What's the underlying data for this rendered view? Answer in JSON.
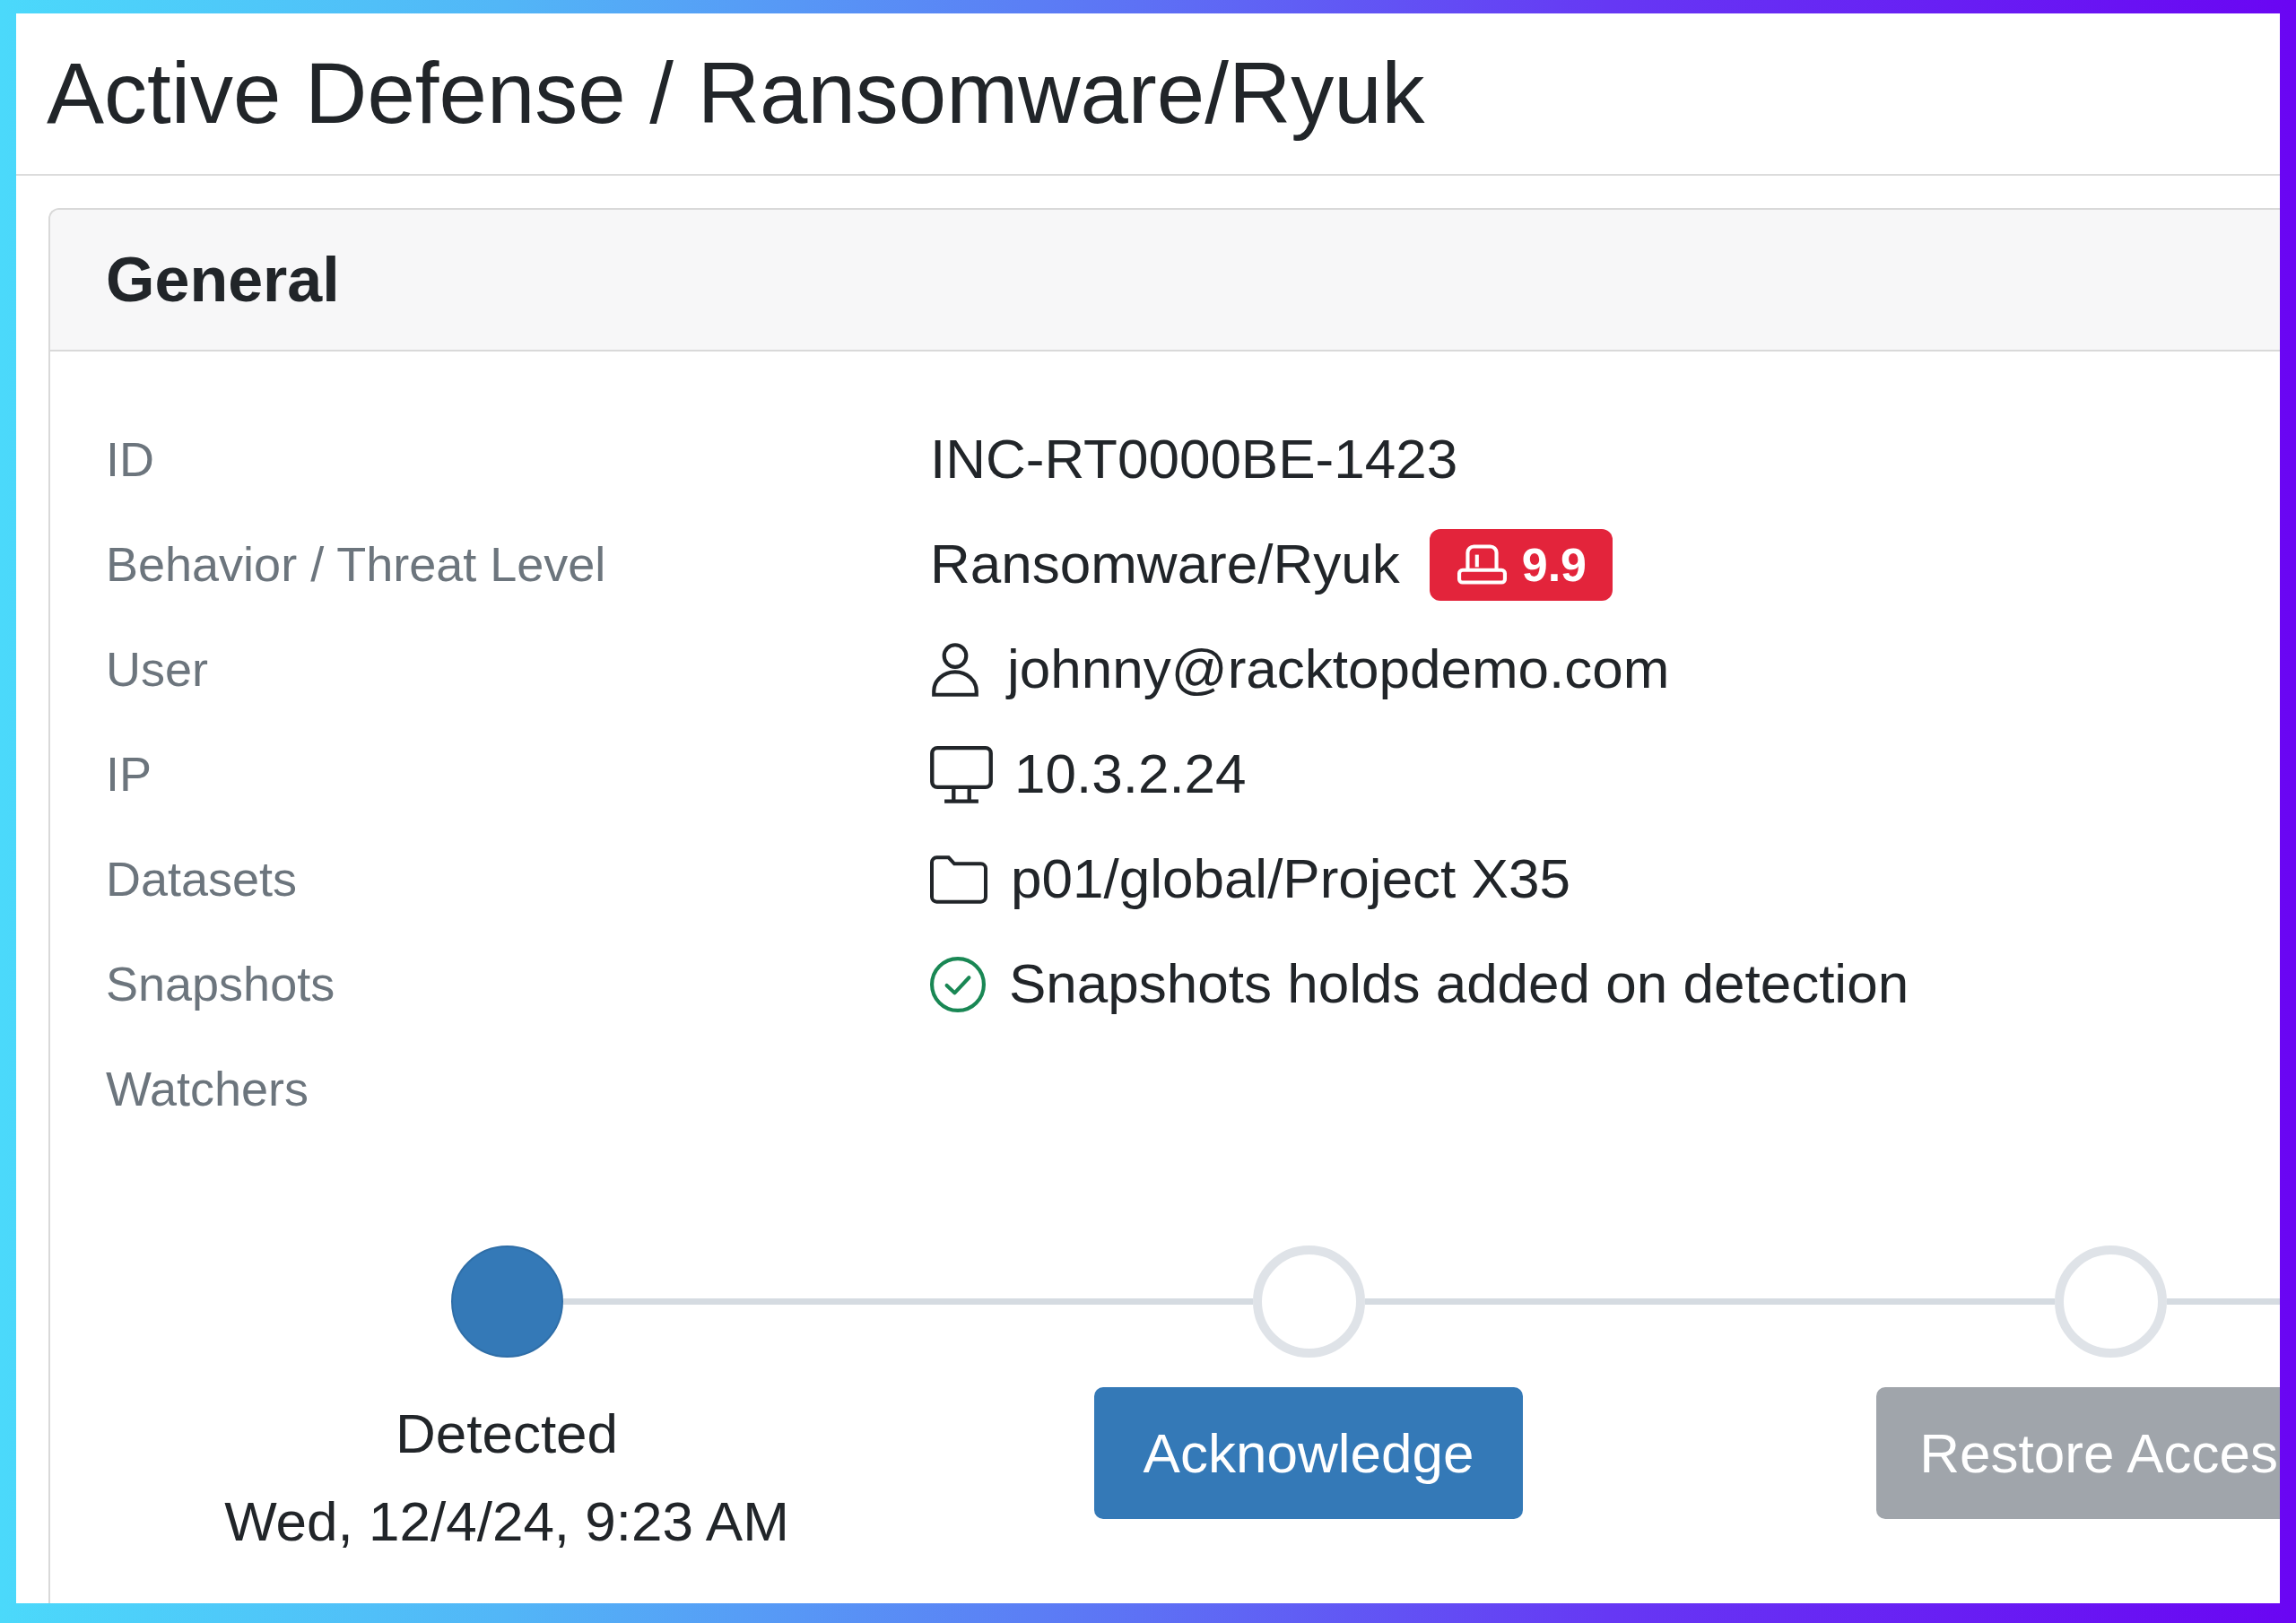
{
  "page": {
    "title": "Active Defense / Ransomware/Ryuk"
  },
  "card": {
    "title": "General",
    "fields": [
      {
        "label": "ID",
        "kind": "plain",
        "value": "INC-RT0000BE-1423"
      },
      {
        "label": "Behavior / Threat Level",
        "kind": "score",
        "value": "Ransomware/Ryuk",
        "badge": "9.9"
      },
      {
        "label": "User",
        "kind": "user",
        "value": "johnny@racktopdemo.com"
      },
      {
        "label": "IP",
        "kind": "host",
        "value": "10.3.2.24"
      },
      {
        "label": "Datasets",
        "kind": "dataset",
        "value": "p01/global/Project X35"
      },
      {
        "label": "Snapshots",
        "kind": "status",
        "value": "Snapshots holds added on detection"
      },
      {
        "label": "Watchers"
      }
    ]
  },
  "timeline": {
    "steps": [
      {
        "kind": "event",
        "completed": true,
        "label": "Detected",
        "time": "Wed, 12/4/24, 9:23 AM"
      },
      {
        "kind": "action",
        "completed": false,
        "button": "Acknowledge",
        "disabled": false
      },
      {
        "kind": "action",
        "completed": false,
        "button": "Restore Acces",
        "disabled": true
      }
    ]
  }
}
